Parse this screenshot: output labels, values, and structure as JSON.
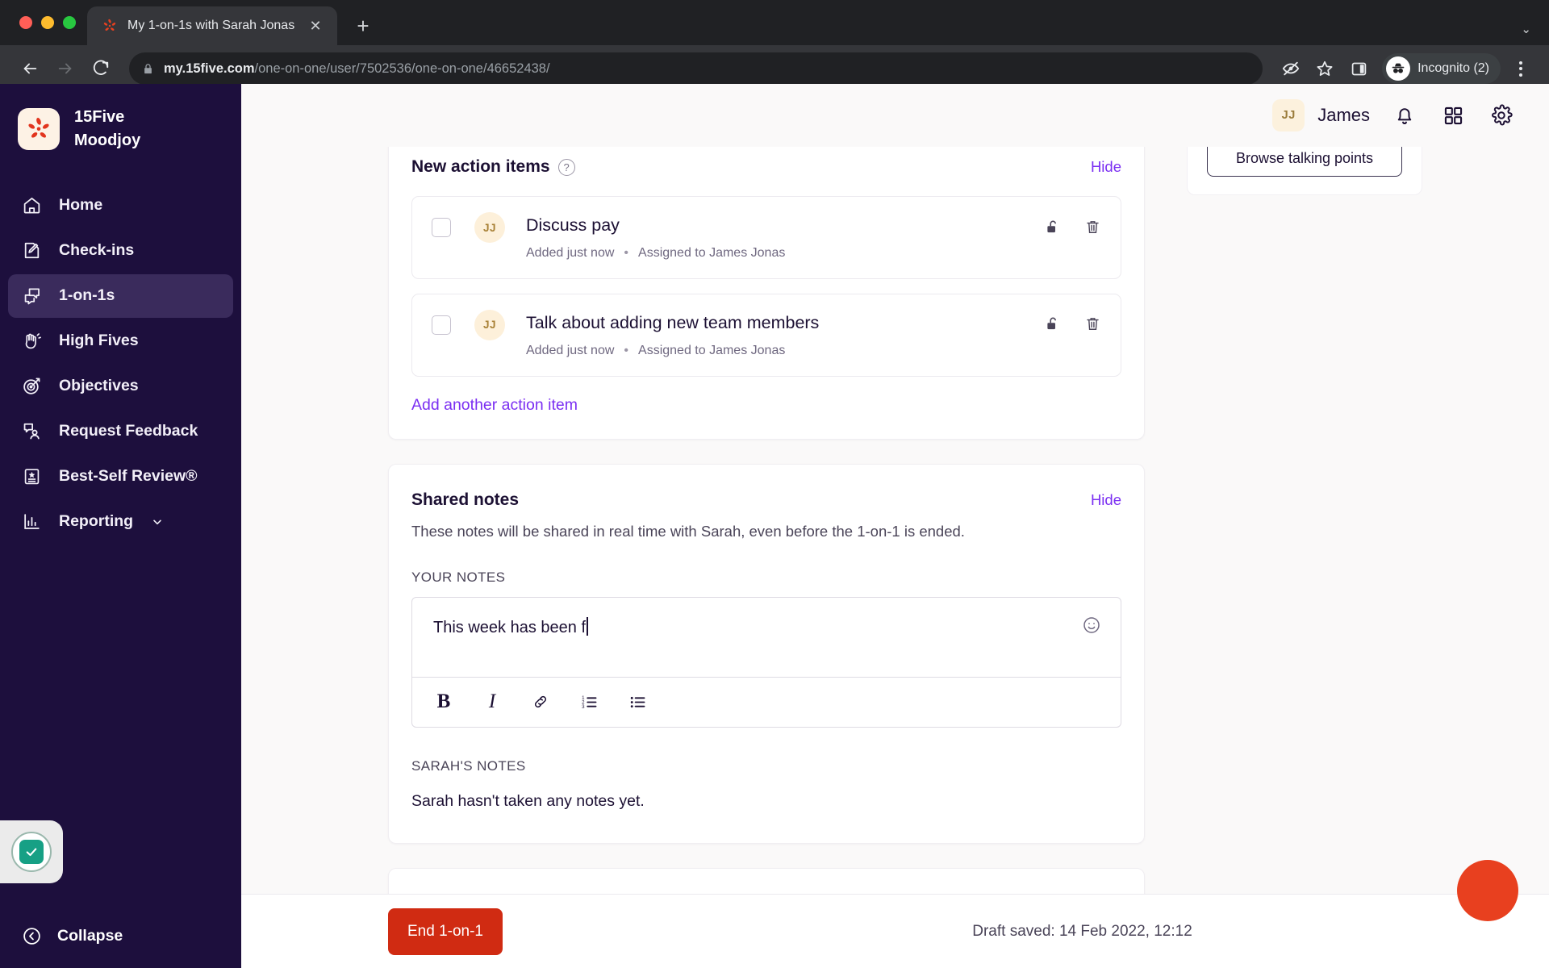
{
  "browser": {
    "tab": {
      "title": "My 1-on-1s with Sarah Jonas",
      "favicon": "15five-logo-icon",
      "close_label": "✕"
    },
    "new_tab_label": "+",
    "tabstrip_menu_label": "⌄",
    "back_label": "←",
    "forward_label": "→",
    "reload_label": "↻",
    "url": {
      "host": "my.15five.com",
      "path": "/one-on-one/user/7502536/one-on-one/46652438/"
    },
    "profile": {
      "label": "Incognito (2)"
    },
    "icons": [
      "eye-slash-icon",
      "star-icon",
      "side-panel-icon",
      "incognito-icon",
      "kebab-menu-icon"
    ]
  },
  "sidebar": {
    "brand": {
      "line1": "15Five",
      "line2": "Moodjoy"
    },
    "items": [
      {
        "label": "Home",
        "icon": "home-icon",
        "active": false
      },
      {
        "label": "Check-ins",
        "icon": "check-ins-icon",
        "active": false
      },
      {
        "label": "1-on-1s",
        "icon": "one-on-ones-icon",
        "active": true
      },
      {
        "label": "High Fives",
        "icon": "high-fives-icon",
        "active": false
      },
      {
        "label": "Objectives",
        "icon": "objectives-icon",
        "active": false
      },
      {
        "label": "Request Feedback",
        "icon": "request-feedback-icon",
        "active": false
      },
      {
        "label": "Best-Self Review®",
        "icon": "best-self-review-icon",
        "active": false
      },
      {
        "label": "Reporting",
        "icon": "reporting-icon",
        "active": false,
        "chevron": true
      }
    ],
    "collapse_label": "Collapse"
  },
  "topbar": {
    "user_initials": "JJ",
    "user_name": "James",
    "icons": [
      "bell-icon",
      "apps-grid-icon",
      "gear-icon"
    ]
  },
  "action_items": {
    "title": "New action items",
    "help_glyph": "?",
    "hide_label": "Hide",
    "add_label": "Add another action item",
    "items": [
      {
        "initials": "JJ",
        "title": "Discuss pay",
        "added": "Added just now",
        "separator": "•",
        "assigned": "Assigned to James Jonas"
      },
      {
        "initials": "JJ",
        "title": "Talk about adding new team members",
        "added": "Added just now",
        "separator": "•",
        "assigned": "Assigned to James Jonas"
      }
    ]
  },
  "shared_notes": {
    "title": "Shared notes",
    "hide_label": "Hide",
    "description": "These notes will be shared in real time with Sarah, even before the 1-on-1 is ended.",
    "your_notes_label": "YOUR NOTES",
    "editor_value": "This week has been f",
    "toolbar": [
      {
        "name": "bold-icon",
        "glyph": "B"
      },
      {
        "name": "italic-icon",
        "glyph": "I"
      },
      {
        "name": "link-icon",
        "glyph": ""
      },
      {
        "name": "ordered-list-icon",
        "glyph": ""
      },
      {
        "name": "bullet-list-icon",
        "glyph": ""
      }
    ],
    "emoji_button": "emoji-icon",
    "sarah_notes_label": "SARAH'S NOTES",
    "sarah_notes_empty": "Sarah hasn't taken any notes yet."
  },
  "right_rail": {
    "browse_label": "Browse talking points"
  },
  "footer": {
    "end_label": "End 1-on-1",
    "draft_saved": "Draft saved: 14 Feb 2022, 12:12"
  },
  "colors": {
    "sidebar": "#1d0f3d",
    "accent_purple": "#7b2ff2",
    "danger_red": "#d02b12",
    "fab_red": "#e8401f",
    "page_bg": "#faf9f9"
  }
}
